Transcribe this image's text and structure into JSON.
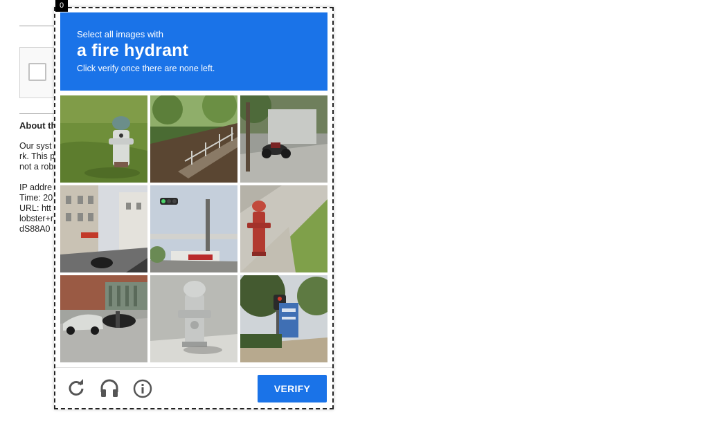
{
  "background": {
    "heading": "About th",
    "body_lines": [
      "Our syst",
      "rk. This p",
      "not a rob"
    ],
    "meta_lines": [
      "IP addre",
      "Time: 20",
      "URL: htt",
      "lobster+r",
      "dS88A0"
    ]
  },
  "challenge": {
    "corner_badge": "0",
    "prompt": {
      "lead": "Select all images with",
      "target": "a fire hydrant",
      "hint": "Click verify once there are none left."
    },
    "tiles": [
      {
        "content": "fire hydrant on grass"
      },
      {
        "content": "wooden stairs on hillside"
      },
      {
        "content": "motorcycles on street"
      },
      {
        "content": "city street with scooter"
      },
      {
        "content": "traffic light and overpass"
      },
      {
        "content": "red fire hydrant on grass"
      },
      {
        "content": "parked cars by building"
      },
      {
        "content": "silver fire hydrant"
      },
      {
        "content": "traffic light and sign"
      }
    ],
    "controls": {
      "reload_icon": "reload-icon",
      "audio_icon": "headphones-icon",
      "info_icon": "info-icon"
    },
    "verify_label": "VERIFY",
    "colors": {
      "accent": "#1a73e8"
    }
  }
}
